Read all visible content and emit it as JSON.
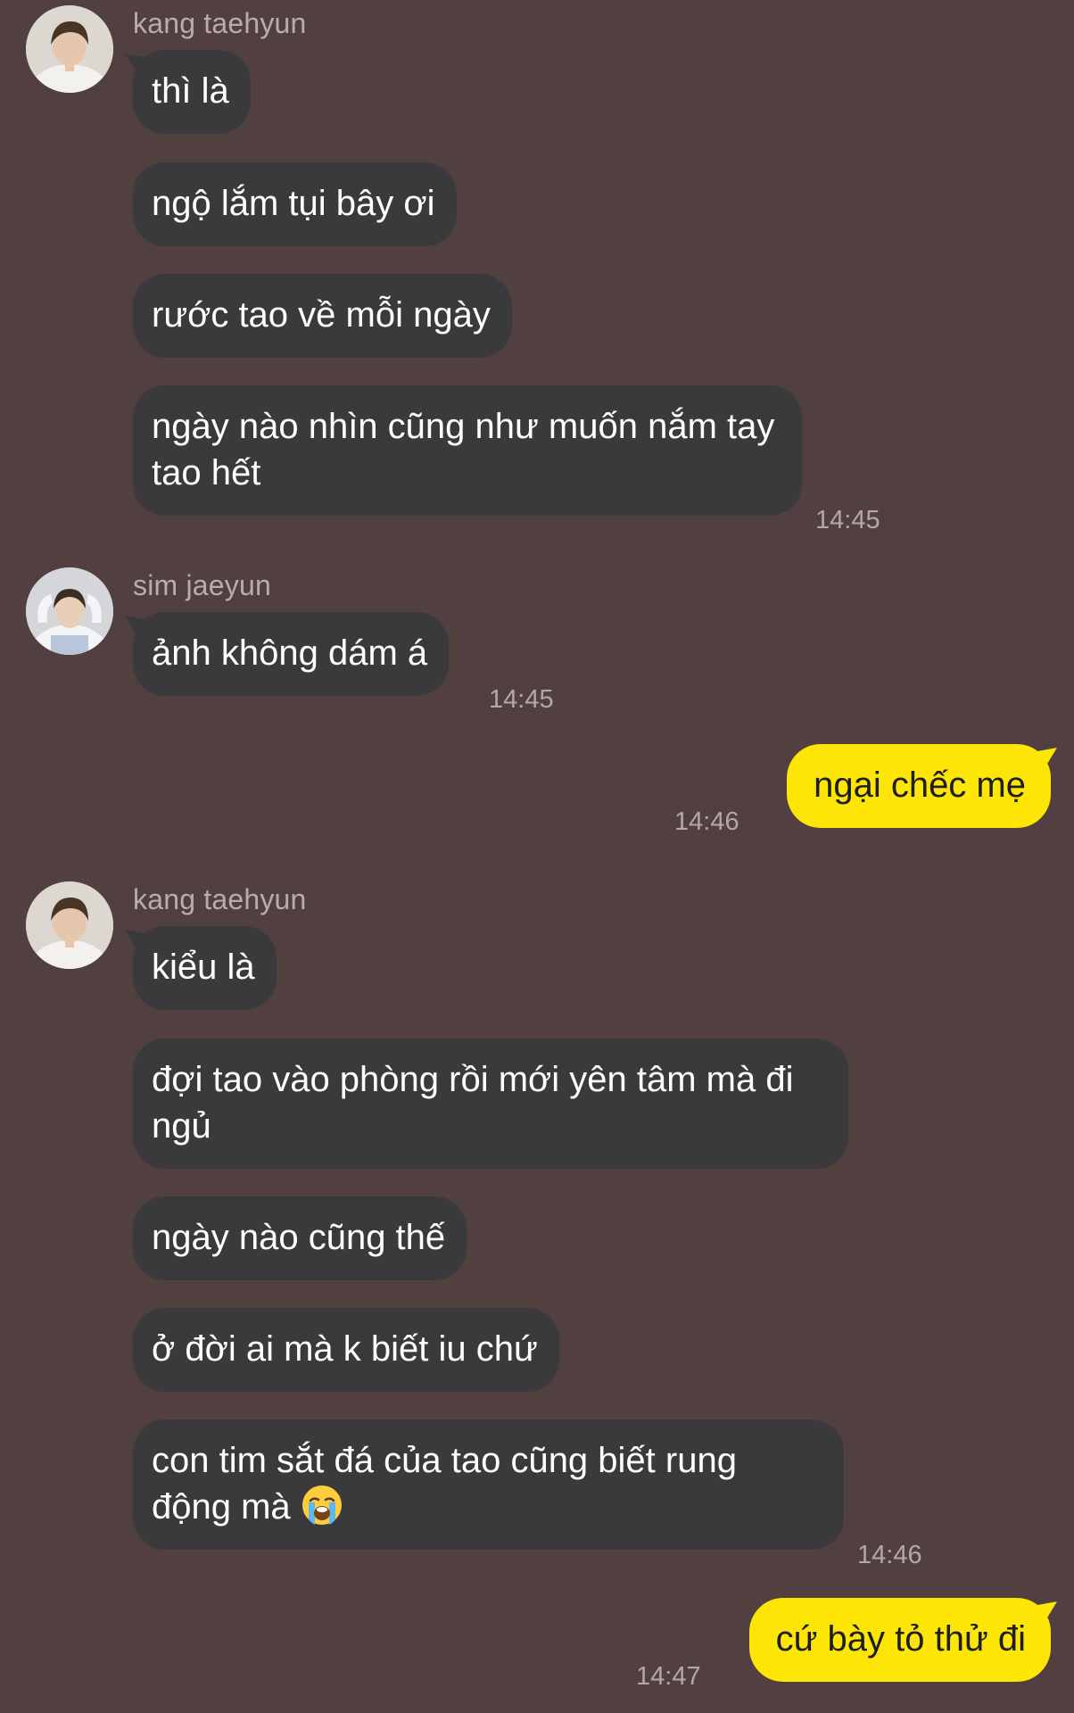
{
  "chat": {
    "groups": [
      {
        "sender": "kang taehyun",
        "avatar_icon": "avatar-kang-taehyun",
        "messages": [
          "thì là",
          "ngộ lắm tụi bây ơi",
          "rước tao về mỗi ngày",
          "ngày nào nhìn cũng như muốn nắm tay tao hết"
        ],
        "time": "14:45"
      },
      {
        "sender": "sim jaeyun",
        "avatar_icon": "avatar-sim-jaeyun",
        "messages": [
          "ảnh không dám á"
        ],
        "time": "14:45"
      },
      {
        "sender": "me",
        "messages": [
          "ngại chếc mẹ"
        ],
        "time": "14:46"
      },
      {
        "sender": "kang taehyun",
        "avatar_icon": "avatar-kang-taehyun",
        "messages": [
          "kiểu là",
          "đợi tao vào phòng rồi mới yên tâm mà đi ngủ",
          "ngày nào cũng thế",
          "ở đời ai mà k biết iu chứ",
          "con tim sắt đá của tao cũng biết rung động mà"
        ],
        "emoji": "loudly-crying-face-icon",
        "time": "14:46"
      },
      {
        "sender": "me",
        "messages": [
          "cứ bày tỏ thử đi"
        ],
        "time": "14:47"
      }
    ]
  },
  "colors": {
    "background": "#523f3f",
    "incoming_bubble": "#3a3a3c",
    "outgoing_bubble": "#fde505",
    "timestamp": "#b3a8a6"
  }
}
